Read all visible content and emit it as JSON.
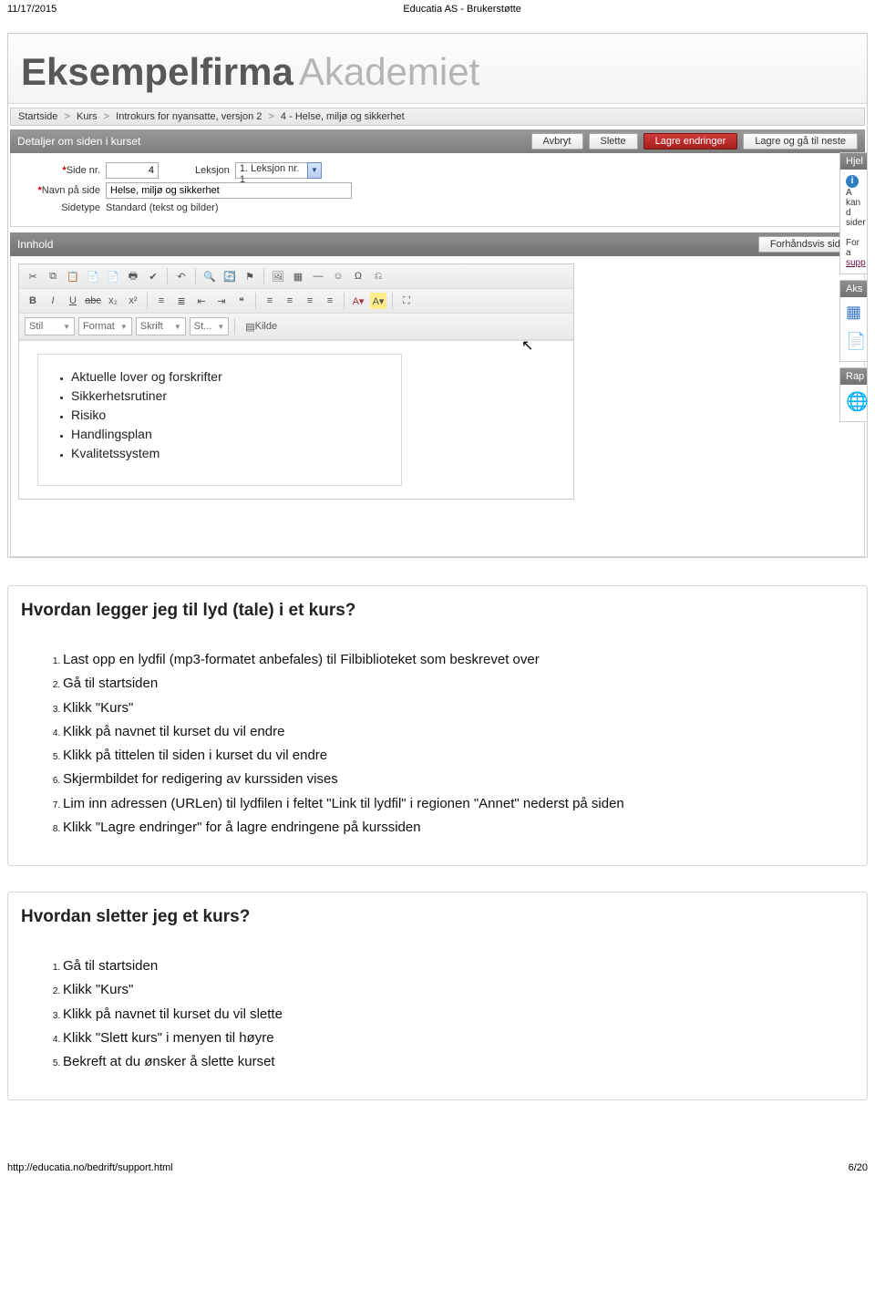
{
  "print": {
    "date": "11/17/2015",
    "title": "Educatia AS - Brukerstøtte",
    "footer_url": "http://educatia.no/bedrift/support.html",
    "page": "6/20"
  },
  "brand": {
    "word1": "Eksempelfirma",
    "word2": "Akademiet"
  },
  "breadcrumbs": {
    "i1": "Startside",
    "i2": "Kurs",
    "i3": "Introkurs for nyansatte, versjon 2",
    "i4": "4 - Helse, miljø og sikkerhet",
    "sep": ">"
  },
  "panel": {
    "title": "Detaljer om siden i kurset",
    "btn_cancel": "Avbryt",
    "btn_delete": "Slette",
    "btn_save": "Lagre endringer",
    "btn_save_next": "Lagre og gå til neste"
  },
  "form": {
    "sidenr_label": "Side nr.",
    "sidenr_value": "4",
    "leksjon_label": "Leksjon",
    "leksjon_value": "1. Leksjon nr. 1",
    "navn_label": "Navn på side",
    "navn_value": "Helse, miljø og sikkerhet",
    "sidetype_label": "Sidetype",
    "sidetype_value": "Standard (tekst og bilder)"
  },
  "content": {
    "header": "Innhold",
    "preview_btn": "Forhåndsvis side",
    "dd_stil": "Stil",
    "dd_format": "Format",
    "dd_skrift": "Skrift",
    "dd_st": "St...",
    "kilde": "Kilde",
    "bullets": {
      "b1": "Aktuelle lover og forskrifter",
      "b2": "Sikkerhetsrutiner",
      "b3": "Risiko",
      "b4": "Handlingsplan",
      "b5": "Kvalitetssystem"
    }
  },
  "side": {
    "hjelp_hd": "Hjel",
    "hjelp_t1": "A",
    "hjelp_t2": "kan d",
    "hjelp_t3": "sider",
    "hjelp_t4": "For a",
    "hjelp_t5": "supp",
    "aks_hd": "Aks",
    "rap_hd": "Rap"
  },
  "faq1": {
    "title": "Hvordan legger jeg til lyd (tale) i et kurs?",
    "s1": "Last opp en lydfil (mp3-formatet anbefales) til Filbiblioteket som beskrevet over",
    "s2": "Gå til startsiden",
    "s3": "Klikk \"Kurs\"",
    "s4": "Klikk på navnet til kurset du vil endre",
    "s5": "Klikk på tittelen til siden i kurset du vil endre",
    "s6": "Skjermbildet for redigering av kurssiden vises",
    "s7": "Lim inn adressen (URLen) til lydfilen i feltet \"Link til lydfil\" i regionen \"Annet\" nederst på siden",
    "s8": "Klikk \"Lagre endringer\" for å lagre endringene på kurssiden"
  },
  "faq2": {
    "title": "Hvordan sletter jeg et kurs?",
    "s1": "Gå til startsiden",
    "s2": "Klikk \"Kurs\"",
    "s3": "Klikk på navnet til kurset du vil slette",
    "s4": "Klikk \"Slett kurs\" i menyen til høyre",
    "s5": "Bekreft at du ønsker å slette kurset"
  }
}
